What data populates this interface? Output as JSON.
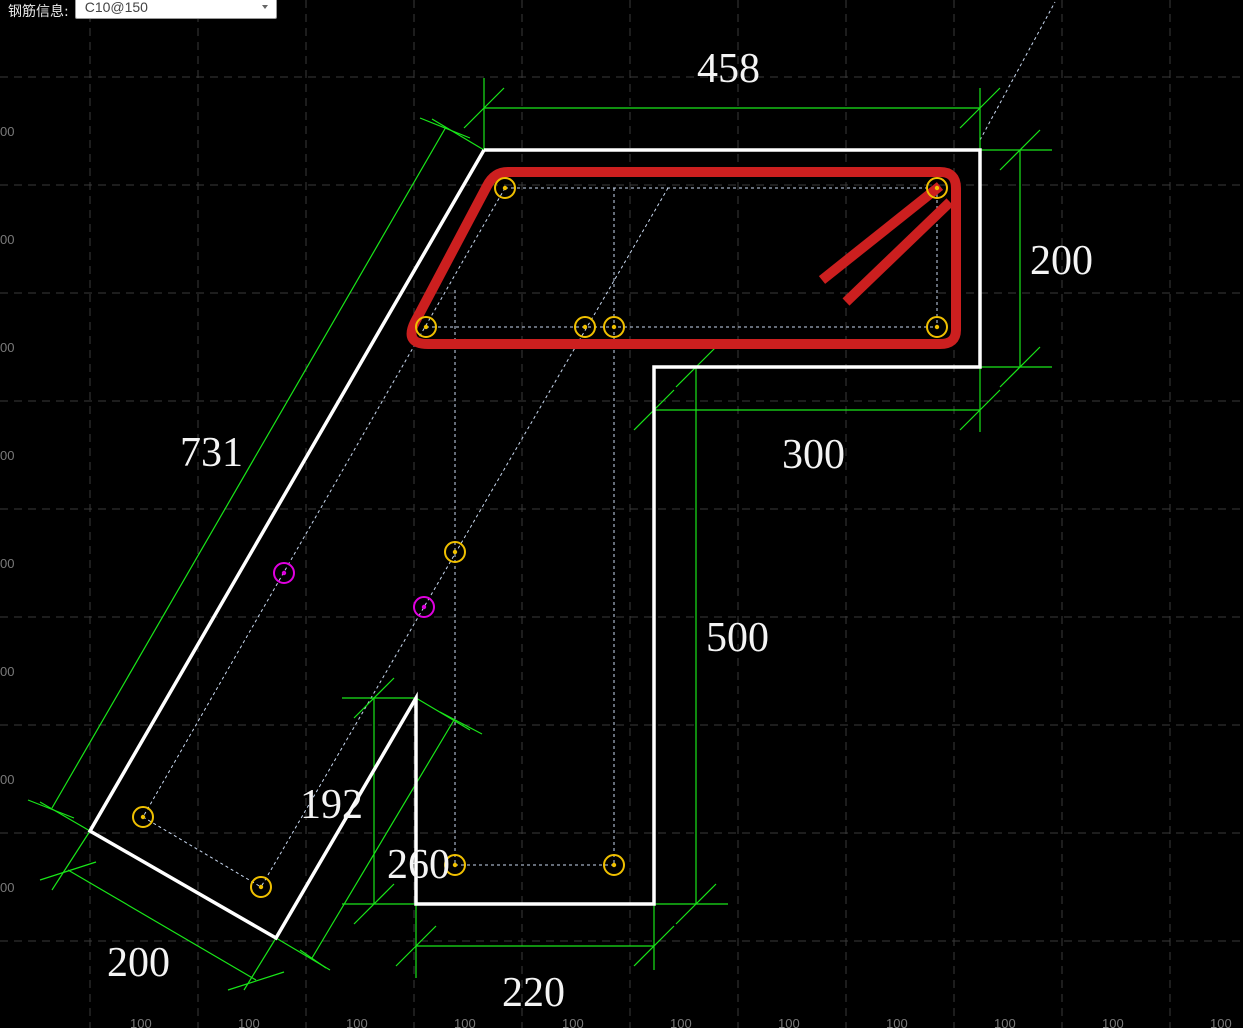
{
  "toolbar": {
    "rebar_info_label": "钢筋信息:",
    "rebar_info_value": "C10@150"
  },
  "drawing": {
    "dimensions": {
      "top_width": "458",
      "right_height": "200",
      "notch_width": "300",
      "slant_length": "731",
      "stem_height": "500",
      "inner_slant": "192",
      "inner_height": "260",
      "bottom_width": "220",
      "end_width": "200"
    },
    "axis_labels": {
      "left": [
        "00",
        "00",
        "00",
        "00",
        "00",
        "00",
        "00",
        "00"
      ],
      "bottom": [
        "100",
        "100",
        "100",
        "100",
        "100",
        "100",
        "100",
        "100",
        "100",
        "100",
        "100"
      ]
    },
    "colors": {
      "outline": "#ffffff",
      "dimension": "#19e619",
      "stirrup": "#cc1f1f",
      "rebar": "#f0c000",
      "rebar_alt": "#e000e0",
      "grid": "#3a3a3a"
    }
  }
}
